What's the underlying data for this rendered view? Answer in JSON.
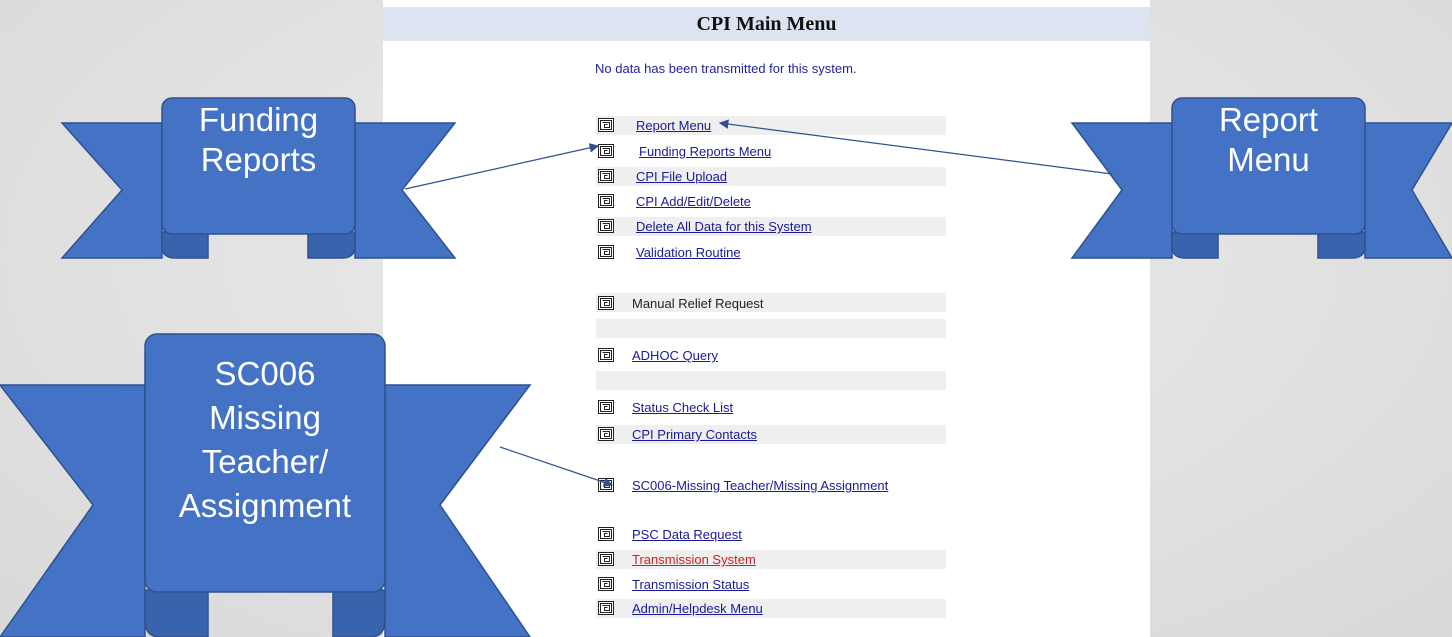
{
  "panel": {
    "title": "CPI Main Menu",
    "notice": "No data has been transmitted for this system."
  },
  "menu": [
    {
      "label": "Report Menu",
      "link": true,
      "shaded": true,
      "icon": "menu-icon"
    },
    {
      "label": "Funding Reports Menu",
      "link": true,
      "shaded": false,
      "icon": "menu-icon"
    },
    {
      "label": "CPI File Upload",
      "link": true,
      "shaded": true,
      "icon": "menu-icon"
    },
    {
      "label": "CPI Add/Edit/Delete",
      "link": true,
      "shaded": false,
      "icon": "menu-icon"
    },
    {
      "label": "Delete All Data for this System",
      "link": true,
      "shaded": true,
      "icon": "menu-icon"
    },
    {
      "label": "Validation Routine",
      "link": true,
      "shaded": false,
      "icon": "menu-icon"
    },
    {
      "label": "Manual Relief Request",
      "link": false,
      "shaded": false,
      "icon": "menu-icon"
    },
    {
      "label": "ADHOC Query",
      "link": true,
      "shaded": false,
      "icon": "menu-icon"
    },
    {
      "label": "Status Check List",
      "link": true,
      "shaded": false,
      "icon": "menu-icon"
    },
    {
      "label": "CPI Primary Contacts",
      "link": true,
      "shaded": true,
      "icon": "menu-icon"
    },
    {
      "label": "SC006-Missing Teacher/Missing Assignment",
      "link": true,
      "shaded": false,
      "icon": "menu-icon"
    },
    {
      "label": "PSC Data Request",
      "link": true,
      "shaded": false,
      "icon": "menu-icon"
    },
    {
      "label": "Transmission System",
      "link": true,
      "shaded": true,
      "icon": "menu-icon",
      "color": "#d02020"
    },
    {
      "label": "Transmission Status",
      "link": true,
      "shaded": false,
      "icon": "menu-icon"
    },
    {
      "label": "Admin/Helpdesk Menu",
      "link": true,
      "shaded": true,
      "icon": "menu-icon"
    }
  ],
  "callouts": {
    "funding": {
      "line1": "Funding",
      "line2": "Reports"
    },
    "report": {
      "line1": "Report",
      "line2": "Menu"
    },
    "sc006": {
      "line1": "SC006",
      "line2": "Missing",
      "line3": "Teacher/",
      "line4": "Assignment"
    }
  },
  "colors": {
    "ribbon_fill": "#4472c4",
    "ribbon_edge": "#2f528f",
    "link": "#1a1a99",
    "title_bar": "#dce4f1"
  }
}
